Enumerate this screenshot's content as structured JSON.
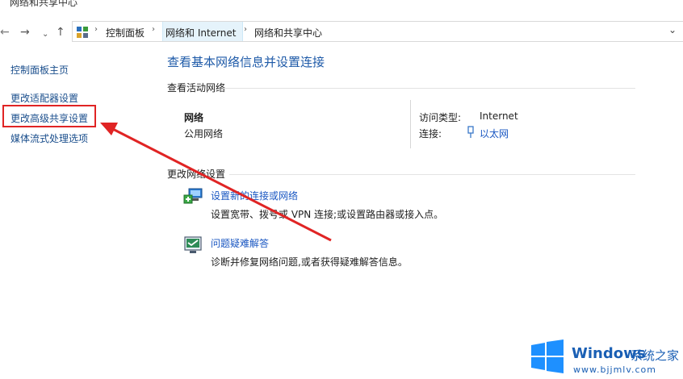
{
  "window": {
    "title": "网络和共享中心"
  },
  "nav": {
    "back_glyph": "←",
    "forward_glyph": "→",
    "dropdown_glyph": "⌄",
    "up_glyph": "↑",
    "expand_glyph": "⌄"
  },
  "breadcrumb": {
    "items": [
      "控制面板",
      "网络和 Internet",
      "网络和共享中心"
    ]
  },
  "sidebar": {
    "items": [
      {
        "label": "控制面板主页"
      },
      {
        "label": "更改适配器设置"
      },
      {
        "label": "更改高级共享设置"
      },
      {
        "label": "媒体流式处理选项"
      }
    ]
  },
  "main": {
    "title": "查看基本网络信息并设置连接",
    "active_networks_label": "查看活动网络",
    "network": {
      "name": "网络",
      "type": "公用网络",
      "access_type_label": "访问类型:",
      "access_type_value": "Internet",
      "connection_label": "连接:",
      "connection_value": "以太网"
    },
    "change_settings_label": "更改网络设置",
    "tasks": [
      {
        "link": "设置新的连接或网络",
        "desc": "设置宽带、拨号或 VPN 连接;或设置路由器或接入点。",
        "icon": "new-connection-icon"
      },
      {
        "link": "问题疑难解答",
        "desc": "诊断并修复网络问题,或者获得疑难解答信息。",
        "icon": "troubleshoot-icon"
      }
    ]
  },
  "watermark": {
    "brand": "Windows",
    "cn_text": "系统之家",
    "url": "www.bjjmlv.com"
  },
  "colors": {
    "link": "#1a57c2",
    "title": "#1e5aa8",
    "annotation": "#e02424"
  }
}
